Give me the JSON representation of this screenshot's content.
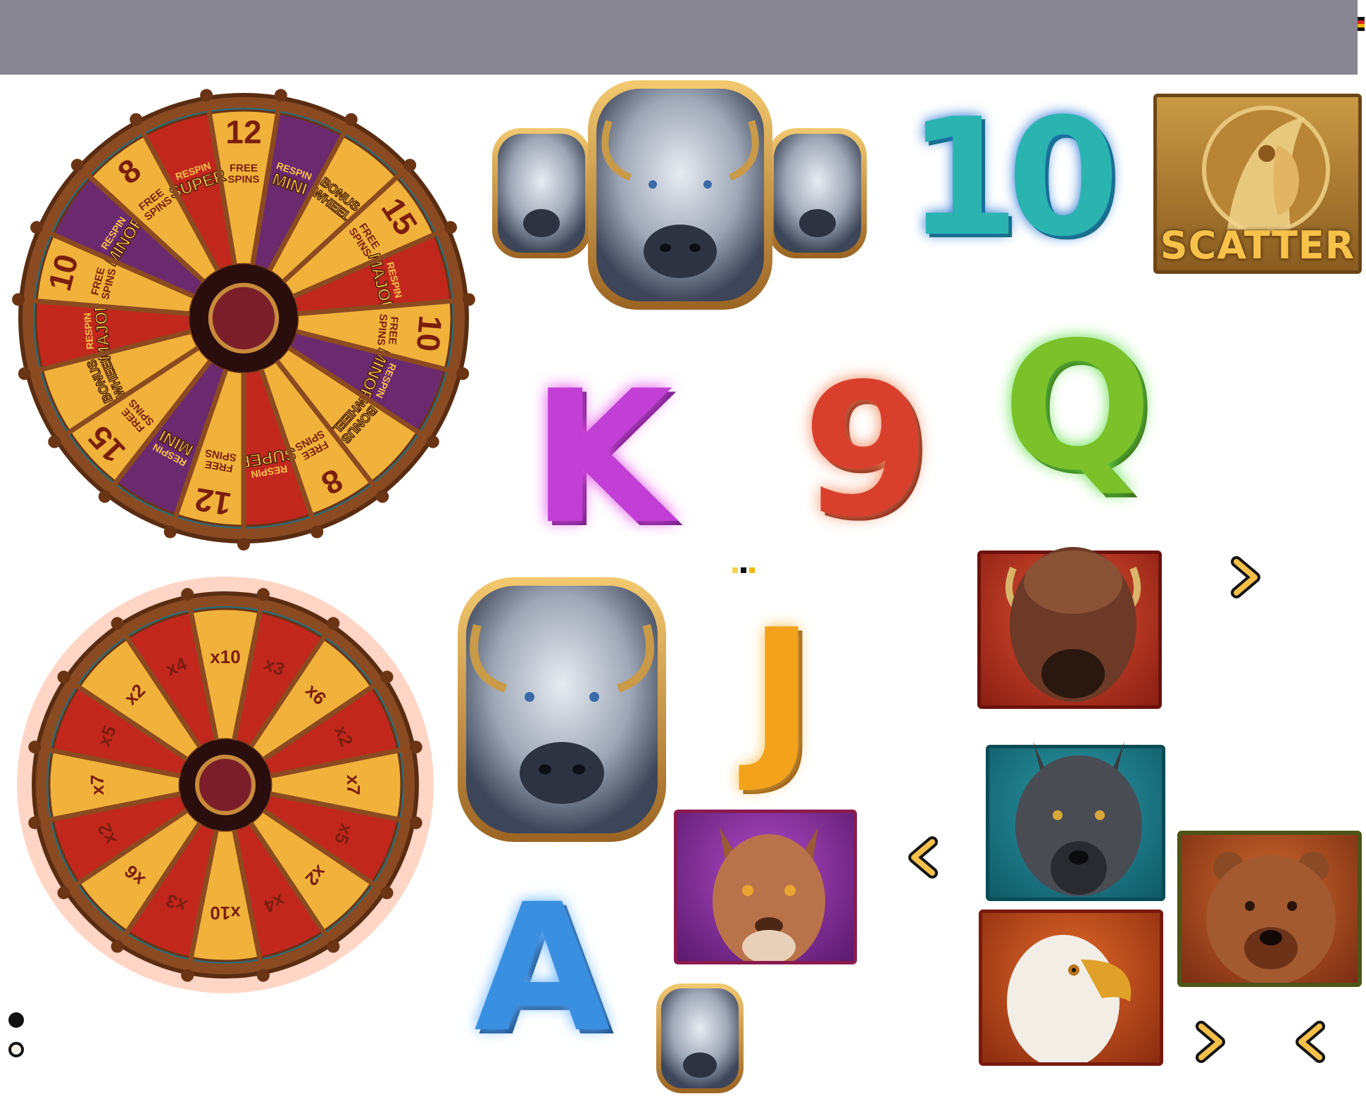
{
  "bonus_wheel": {
    "segments": [
      {
        "big": "12",
        "small": "FREE SPINS",
        "kind": "fs"
      },
      {
        "big": "",
        "small": "MINI",
        "top": "RESPIN",
        "kind": "jp_purple"
      },
      {
        "big": "",
        "small": "BONUS WHEEL",
        "kind": "bw"
      },
      {
        "big": "15",
        "small": "FREE SPINS",
        "kind": "fs"
      },
      {
        "big": "",
        "small": "MAJOR",
        "top": "RESPIN",
        "kind": "jp_red"
      },
      {
        "big": "10",
        "small": "FREE SPINS",
        "kind": "fs"
      },
      {
        "big": "",
        "small": "MINOR",
        "top": "RESPIN",
        "kind": "jp_purple"
      },
      {
        "big": "",
        "small": "BONUS WHEEL",
        "kind": "bw"
      },
      {
        "big": "8",
        "small": "FREE SPINS",
        "kind": "fs"
      },
      {
        "big": "",
        "small": "SUPER",
        "top": "RESPIN",
        "kind": "jp_red"
      },
      {
        "big": "12",
        "small": "FREE SPINS",
        "kind": "fs"
      },
      {
        "big": "",
        "small": "MINI",
        "top": "RESPIN",
        "kind": "jp_purple"
      },
      {
        "big": "15",
        "small": "FREE SPINS",
        "kind": "fs"
      },
      {
        "big": "",
        "small": "BONUS WHEEL",
        "kind": "bw"
      },
      {
        "big": "",
        "small": "MAJOR",
        "top": "RESPIN",
        "kind": "jp_red"
      },
      {
        "big": "10",
        "small": "FREE SPINS",
        "kind": "fs"
      },
      {
        "big": "",
        "small": "MINOR",
        "top": "RESPIN",
        "kind": "jp_purple"
      },
      {
        "big": "8",
        "small": "FREE SPINS",
        "kind": "fs"
      },
      {
        "big": "",
        "small": "SUPER",
        "top": "RESPIN",
        "kind": "jp_red"
      }
    ]
  },
  "multiplier_wheel": {
    "segments": [
      "x10",
      "x3",
      "x6",
      "x2",
      "x7",
      "x5",
      "x2",
      "x4",
      "x10",
      "x3",
      "x6",
      "x2",
      "x7",
      "x5",
      "x2",
      "x4"
    ]
  },
  "symbols": {
    "ten": "10",
    "king": "K",
    "nine": "9",
    "queen": "Q",
    "jack": "J",
    "ace": "A",
    "scatter": "SCATTER"
  },
  "icons": {
    "bison": "bison-icon",
    "chief": "chief-icon",
    "red_bison": "red-bison-icon",
    "wolf": "wolf-icon",
    "cougar": "cougar-icon",
    "eagle": "eagle-icon",
    "bear": "bear-icon",
    "next": "chevron-right-icon",
    "prev": "chevron-left-icon"
  },
  "colors": {
    "topbar": "#878590",
    "wheel_rim": "#8a4a22",
    "wheel_gold": "#f0b23a",
    "wheel_red": "#c2271e",
    "wheel_purple": "#6b2a6e",
    "ten": "#2bb3b0",
    "king": "#c23fd6",
    "nine": "#d8402d",
    "queen": "#7cc12a",
    "jack": "#f2a21b",
    "ace": "#3b8fe0",
    "scatter_gold": "#f6c24a"
  }
}
